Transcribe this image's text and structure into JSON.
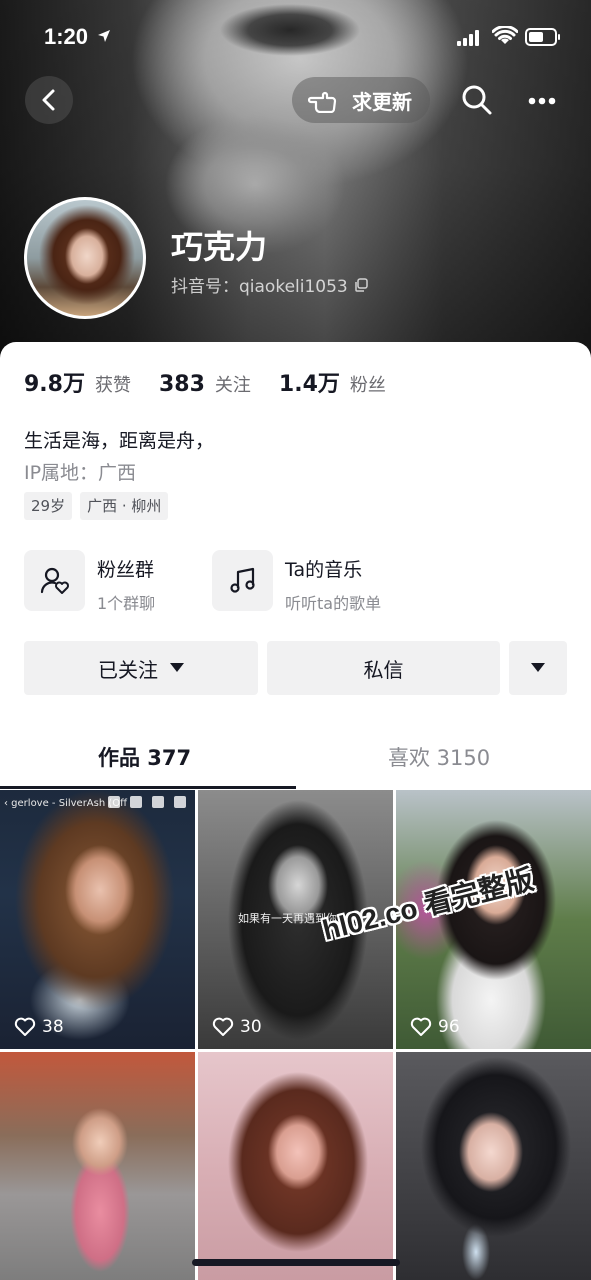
{
  "status_bar": {
    "time": "1:20"
  },
  "nav": {
    "update_label": "求更新"
  },
  "profile": {
    "name": "巧克力",
    "douyin_id": "抖音号：qiaokeli1053"
  },
  "stats": [
    {
      "num": "9.8万",
      "label": "获赞"
    },
    {
      "num": "383",
      "label": "关注"
    },
    {
      "num": "1.4万",
      "label": "粉丝"
    }
  ],
  "bio": "生活是海，距离是舟，",
  "ip": "IP属地：广西",
  "tags": [
    "29岁",
    "广西 · 柳州"
  ],
  "features": [
    {
      "title": "粉丝群",
      "sub": "1个群聊"
    },
    {
      "title": "Ta的音乐",
      "sub": "听听ta的歌单"
    }
  ],
  "actions": {
    "follow": "已关注",
    "message": "私信"
  },
  "tabs": {
    "works": "作品 377",
    "likes": "喜欢 3150"
  },
  "videos": [
    {
      "likes": "38",
      "caption": "‹ gerlove - SilverAsh (Off"
    },
    {
      "likes": "30",
      "caption": "如果有一天再遇到你"
    },
    {
      "likes": "96"
    },
    {},
    {},
    {}
  ],
  "watermark": "hl02.co 看完整版",
  "colors": {
    "text": "#161823",
    "secondary": "#8a8b91",
    "button_bg": "#f1f1f2"
  }
}
